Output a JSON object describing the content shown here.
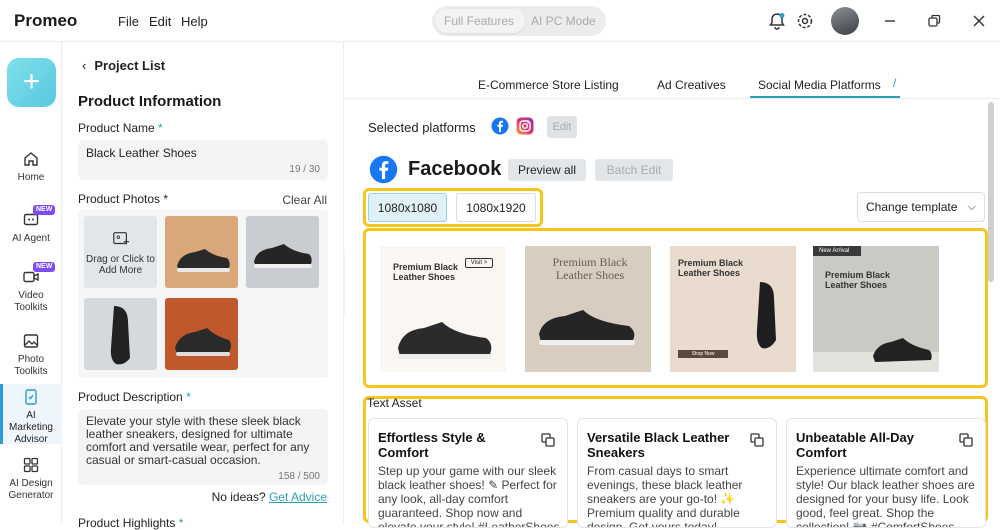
{
  "app": {
    "name": "Promeo",
    "menu": [
      "File",
      "Edit",
      "Help"
    ]
  },
  "mode_toggle": {
    "active": "Full Features",
    "inactive": "AI PC Mode"
  },
  "nav": {
    "create_label": "+",
    "items": [
      {
        "label": "Home",
        "icon": "home-icon",
        "badge": ""
      },
      {
        "label": "AI Agent",
        "icon": "ai-agent-icon",
        "badge": "NEW"
      },
      {
        "label": "Video Toolkits",
        "icon": "video-icon",
        "badge": "NEW"
      },
      {
        "label": "Photo Toolkits",
        "icon": "photo-icon",
        "badge": ""
      },
      {
        "label": "AI Marketing Advisor",
        "icon": "marketing-icon",
        "badge": "",
        "active": true
      },
      {
        "label": "AI Design Generator",
        "icon": "grid-icon",
        "badge": ""
      }
    ]
  },
  "form": {
    "back_label": "Project List",
    "section_title": "Product Information",
    "product_name_label": "Product Name",
    "product_name_value": "Black Leather Shoes",
    "product_name_count": "19 / 30",
    "photos_label": "Product Photos",
    "clear_all": "Clear All",
    "upload_text": "Drag or Click to Add More",
    "description_label": "Product Description",
    "description_value": "Elevate your style with these sleek black leather sneakers, designed for ultimate comfort and versatile wear, perfect for any casual or smart-casual occasion.",
    "description_count": "158 / 500",
    "no_ideas": "No ideas?",
    "get_advice": "Get Advice",
    "highlights_label": "Product Highlights"
  },
  "tabs": [
    "E-Commerce Store Listing",
    "Ad Creatives",
    "Social Media Platforms"
  ],
  "active_tab": "Social Media Platforms",
  "platforms": {
    "label": "Selected platforms",
    "edit": "Edit"
  },
  "facebook": {
    "title": "Facebook",
    "preview_all": "Preview all",
    "batch_edit": "Batch Edit"
  },
  "sizes": [
    "1080x1080",
    "1080x1920"
  ],
  "selected_size": "1080x1080",
  "change_template": "Change template",
  "templates": [
    {
      "title": "Premium Black Leather Shoes",
      "button": "Visit >",
      "tag": ""
    },
    {
      "title": "Premium Black Leather Shoes",
      "button": "",
      "tag": ""
    },
    {
      "title": "Premium Black Leather Shoes",
      "button": "Shop Now",
      "tag": ""
    },
    {
      "title": "Premium Black Leather Shoes",
      "button": "",
      "tag": "New Arrival"
    }
  ],
  "text_asset": {
    "heading": "Text Asset",
    "cards": [
      {
        "title": "Effortless Style & Comfort",
        "body": "Step up your game with our sleek black leather shoes! ✎ Perfect for any look, all-day comfort guaranteed. Shop now and elevate your style! #LeatherShoes"
      },
      {
        "title": "Versatile Black Leather Sneakers",
        "body": "From casual days to smart evenings, these black leather sneakers are your go-to! ✨ Premium quality and durable design. Get yours today!"
      },
      {
        "title": "Unbeatable All-Day Comfort",
        "body": "Experience ultimate comfort and style! Our black leather shoes are designed for your busy life. Look good, feel great. Shop the collection! 📷 #ComfortShoes"
      }
    ]
  },
  "colors": {
    "accent": "#2a9fb5",
    "highlight": "#f5c51b",
    "facebook": "#1877f2"
  }
}
